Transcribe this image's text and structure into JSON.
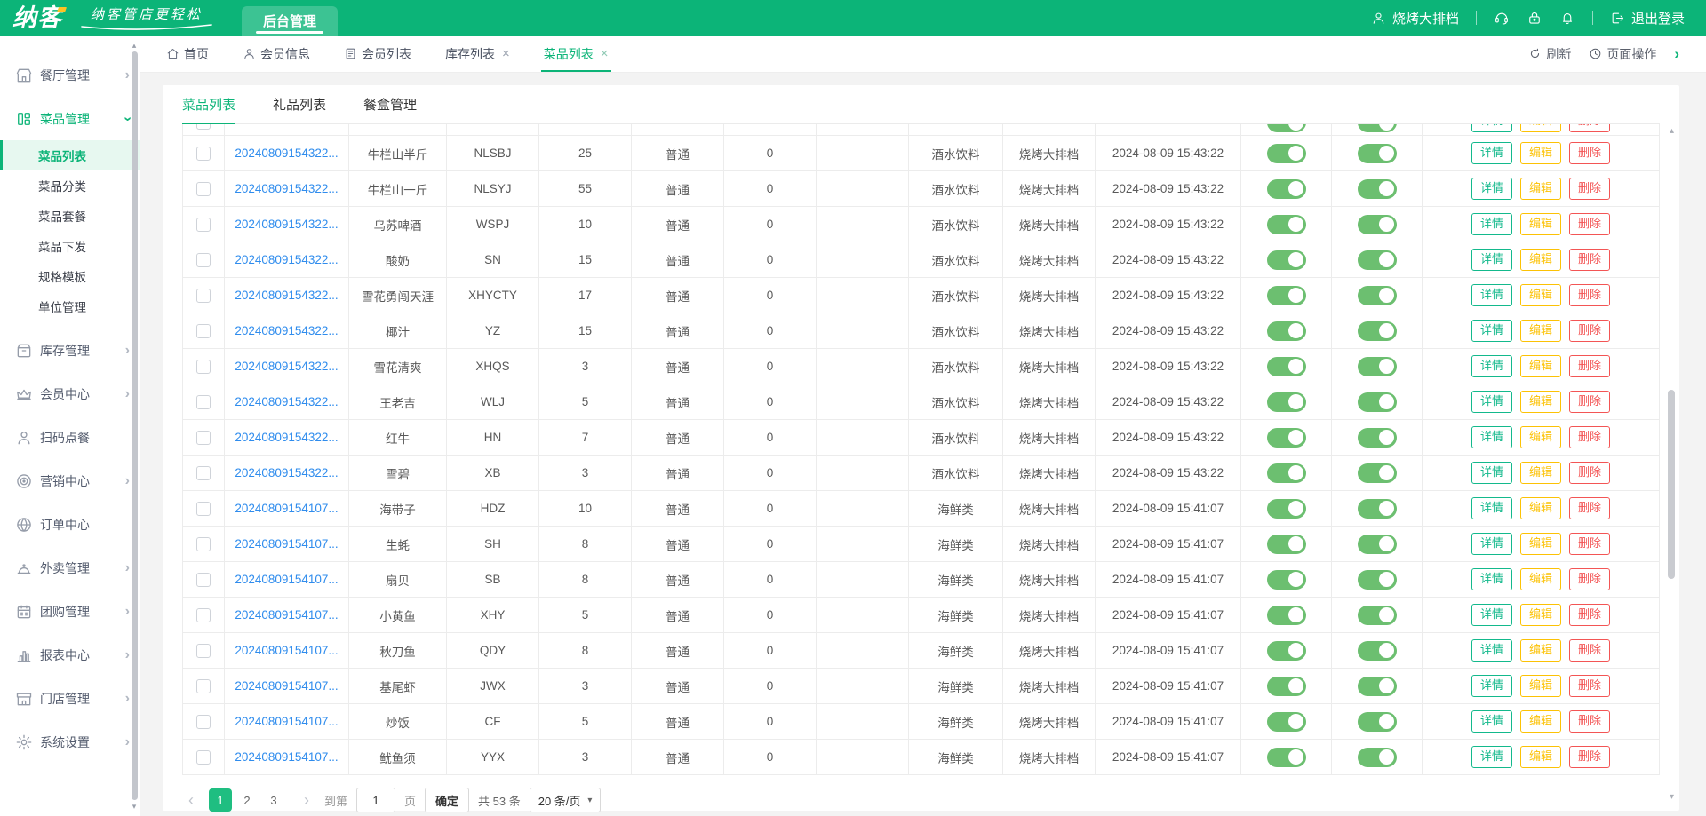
{
  "colors": {
    "brand_green": "#0cb478",
    "toggle_on_green": "#6cbf70",
    "link_blue": "#2f8ced",
    "detail_button_green": "#13b98c",
    "edit_button_yellow": "#fcc205",
    "delete_button_red": "#f35555",
    "active_page_green": "#1fbe81"
  },
  "header": {
    "logo_text": "纳客",
    "slogan": "纳客管店更轻松",
    "nav_tab": "后台管理",
    "user_name": "烧烤大排档",
    "logout_label": "退出登录"
  },
  "sidebar": {
    "items": [
      {
        "key": "restaurant",
        "label": "餐厅管理",
        "expandable": true,
        "expanded": false,
        "active": false
      },
      {
        "key": "dish",
        "label": "菜品管理",
        "expandable": true,
        "expanded": true,
        "active": true,
        "children": [
          {
            "key": "dish-list",
            "label": "菜品列表",
            "active": true
          },
          {
            "key": "dish-category",
            "label": "菜品分类",
            "active": false
          },
          {
            "key": "dish-combo",
            "label": "菜品套餐",
            "active": false
          },
          {
            "key": "dish-dispatch",
            "label": "菜品下发",
            "active": false
          },
          {
            "key": "spec-template",
            "label": "规格模板",
            "active": false
          },
          {
            "key": "unit-mgmt",
            "label": "单位管理",
            "active": false
          }
        ]
      },
      {
        "key": "inventory",
        "label": "库存管理",
        "expandable": true,
        "expanded": false,
        "active": false
      },
      {
        "key": "member",
        "label": "会员中心",
        "expandable": true,
        "expanded": false,
        "active": false
      },
      {
        "key": "scan-order",
        "label": "扫码点餐",
        "expandable": false,
        "active": false
      },
      {
        "key": "marketing",
        "label": "营销中心",
        "expandable": true,
        "expanded": false,
        "active": false
      },
      {
        "key": "order",
        "label": "订单中心",
        "expandable": false,
        "active": false
      },
      {
        "key": "takeout",
        "label": "外卖管理",
        "expandable": true,
        "expanded": false,
        "active": false
      },
      {
        "key": "groupbuy",
        "label": "团购管理",
        "expandable": true,
        "expanded": false,
        "active": false
      },
      {
        "key": "report",
        "label": "报表中心",
        "expandable": true,
        "expanded": false,
        "active": false
      },
      {
        "key": "store",
        "label": "门店管理",
        "expandable": true,
        "expanded": false,
        "active": false
      },
      {
        "key": "settings",
        "label": "系统设置",
        "expandable": true,
        "expanded": false,
        "active": false
      }
    ]
  },
  "tabbar": {
    "tabs": [
      {
        "key": "home",
        "label": "首页",
        "icon": "home",
        "closable": false,
        "active": false
      },
      {
        "key": "member-info",
        "label": "会员信息",
        "icon": "user",
        "closable": false,
        "active": false
      },
      {
        "key": "member-list",
        "label": "会员列表",
        "icon": "doc",
        "closable": false,
        "active": false
      },
      {
        "key": "inventory-list",
        "label": "库存列表",
        "icon": null,
        "closable": true,
        "active": false
      },
      {
        "key": "dish-list",
        "label": "菜品列表",
        "icon": null,
        "closable": true,
        "active": true
      }
    ],
    "refresh_label": "刷新",
    "page_ops_label": "页面操作"
  },
  "subtabs": [
    {
      "key": "dish-list",
      "label": "菜品列表",
      "active": true
    },
    {
      "key": "gift-list",
      "label": "礼品列表",
      "active": false
    },
    {
      "key": "mealbox-mgmt",
      "label": "餐盒管理",
      "active": false
    }
  ],
  "table": {
    "partial_top_row": true,
    "action_labels": [
      "详情",
      "编辑",
      "删除"
    ],
    "rows": [
      {
        "id": "20240809154322...",
        "name": "牛栏山半斤",
        "code": "NLSBJ",
        "price": "25",
        "type": "普通",
        "stock": "0",
        "extra": "",
        "category": "酒水饮料",
        "store": "烧烤大排档",
        "created": "2024-08-09 15:43:22",
        "toggle1": true,
        "toggle2": true
      },
      {
        "id": "20240809154322...",
        "name": "牛栏山一斤",
        "code": "NLSYJ",
        "price": "55",
        "type": "普通",
        "stock": "0",
        "extra": "",
        "category": "酒水饮料",
        "store": "烧烤大排档",
        "created": "2024-08-09 15:43:22",
        "toggle1": true,
        "toggle2": true
      },
      {
        "id": "20240809154322...",
        "name": "乌苏啤酒",
        "code": "WSPJ",
        "price": "10",
        "type": "普通",
        "stock": "0",
        "extra": "",
        "category": "酒水饮料",
        "store": "烧烤大排档",
        "created": "2024-08-09 15:43:22",
        "toggle1": true,
        "toggle2": true
      },
      {
        "id": "20240809154322...",
        "name": "酸奶",
        "code": "SN",
        "price": "15",
        "type": "普通",
        "stock": "0",
        "extra": "",
        "category": "酒水饮料",
        "store": "烧烤大排档",
        "created": "2024-08-09 15:43:22",
        "toggle1": true,
        "toggle2": true
      },
      {
        "id": "20240809154322...",
        "name": "雪花勇闯天涯",
        "code": "XHYCTY",
        "price": "17",
        "type": "普通",
        "stock": "0",
        "extra": "",
        "category": "酒水饮料",
        "store": "烧烤大排档",
        "created": "2024-08-09 15:43:22",
        "toggle1": true,
        "toggle2": true
      },
      {
        "id": "20240809154322...",
        "name": "椰汁",
        "code": "YZ",
        "price": "15",
        "type": "普通",
        "stock": "0",
        "extra": "",
        "category": "酒水饮料",
        "store": "烧烤大排档",
        "created": "2024-08-09 15:43:22",
        "toggle1": true,
        "toggle2": true
      },
      {
        "id": "20240809154322...",
        "name": "雪花清爽",
        "code": "XHQS",
        "price": "3",
        "type": "普通",
        "stock": "0",
        "extra": "",
        "category": "酒水饮料",
        "store": "烧烤大排档",
        "created": "2024-08-09 15:43:22",
        "toggle1": true,
        "toggle2": true
      },
      {
        "id": "20240809154322...",
        "name": "王老吉",
        "code": "WLJ",
        "price": "5",
        "type": "普通",
        "stock": "0",
        "extra": "",
        "category": "酒水饮料",
        "store": "烧烤大排档",
        "created": "2024-08-09 15:43:22",
        "toggle1": true,
        "toggle2": true
      },
      {
        "id": "20240809154322...",
        "name": "红牛",
        "code": "HN",
        "price": "7",
        "type": "普通",
        "stock": "0",
        "extra": "",
        "category": "酒水饮料",
        "store": "烧烤大排档",
        "created": "2024-08-09 15:43:22",
        "toggle1": true,
        "toggle2": true
      },
      {
        "id": "20240809154322...",
        "name": "雪碧",
        "code": "XB",
        "price": "3",
        "type": "普通",
        "stock": "0",
        "extra": "",
        "category": "酒水饮料",
        "store": "烧烤大排档",
        "created": "2024-08-09 15:43:22",
        "toggle1": true,
        "toggle2": true
      },
      {
        "id": "20240809154107...",
        "name": "海带子",
        "code": "HDZ",
        "price": "10",
        "type": "普通",
        "stock": "0",
        "extra": "",
        "category": "海鲜类",
        "store": "烧烤大排档",
        "created": "2024-08-09 15:41:07",
        "toggle1": true,
        "toggle2": true
      },
      {
        "id": "20240809154107...",
        "name": "生蚝",
        "code": "SH",
        "price": "8",
        "type": "普通",
        "stock": "0",
        "extra": "",
        "category": "海鲜类",
        "store": "烧烤大排档",
        "created": "2024-08-09 15:41:07",
        "toggle1": true,
        "toggle2": true
      },
      {
        "id": "20240809154107...",
        "name": "扇贝",
        "code": "SB",
        "price": "8",
        "type": "普通",
        "stock": "0",
        "extra": "",
        "category": "海鲜类",
        "store": "烧烤大排档",
        "created": "2024-08-09 15:41:07",
        "toggle1": true,
        "toggle2": true
      },
      {
        "id": "20240809154107...",
        "name": "小黄鱼",
        "code": "XHY",
        "price": "5",
        "type": "普通",
        "stock": "0",
        "extra": "",
        "category": "海鲜类",
        "store": "烧烤大排档",
        "created": "2024-08-09 15:41:07",
        "toggle1": true,
        "toggle2": true
      },
      {
        "id": "20240809154107...",
        "name": "秋刀鱼",
        "code": "QDY",
        "price": "8",
        "type": "普通",
        "stock": "0",
        "extra": "",
        "category": "海鲜类",
        "store": "烧烤大排档",
        "created": "2024-08-09 15:41:07",
        "toggle1": true,
        "toggle2": true
      },
      {
        "id": "20240809154107...",
        "name": "基尾虾",
        "code": "JWX",
        "price": "3",
        "type": "普通",
        "stock": "0",
        "extra": "",
        "category": "海鲜类",
        "store": "烧烤大排档",
        "created": "2024-08-09 15:41:07",
        "toggle1": true,
        "toggle2": true
      },
      {
        "id": "20240809154107...",
        "name": "炒饭",
        "code": "CF",
        "price": "5",
        "type": "普通",
        "stock": "0",
        "extra": "",
        "category": "海鲜类",
        "store": "烧烤大排档",
        "created": "2024-08-09 15:41:07",
        "toggle1": true,
        "toggle2": true
      },
      {
        "id": "20240809154107...",
        "name": "鱿鱼须",
        "code": "YYX",
        "price": "3",
        "type": "普通",
        "stock": "0",
        "extra": "",
        "category": "海鲜类",
        "store": "烧烤大排档",
        "created": "2024-08-09 15:41:07",
        "toggle1": true,
        "toggle2": true
      }
    ]
  },
  "pagination": {
    "prev": "‹",
    "next": "›",
    "pages": [
      "1",
      "2",
      "3"
    ],
    "current_page": "1",
    "goto_prefix": "到第",
    "goto_value": "1",
    "goto_suffix": "页",
    "confirm_label": "确定",
    "total_label": "共 53 条",
    "page_size_label": "20 条/页"
  }
}
